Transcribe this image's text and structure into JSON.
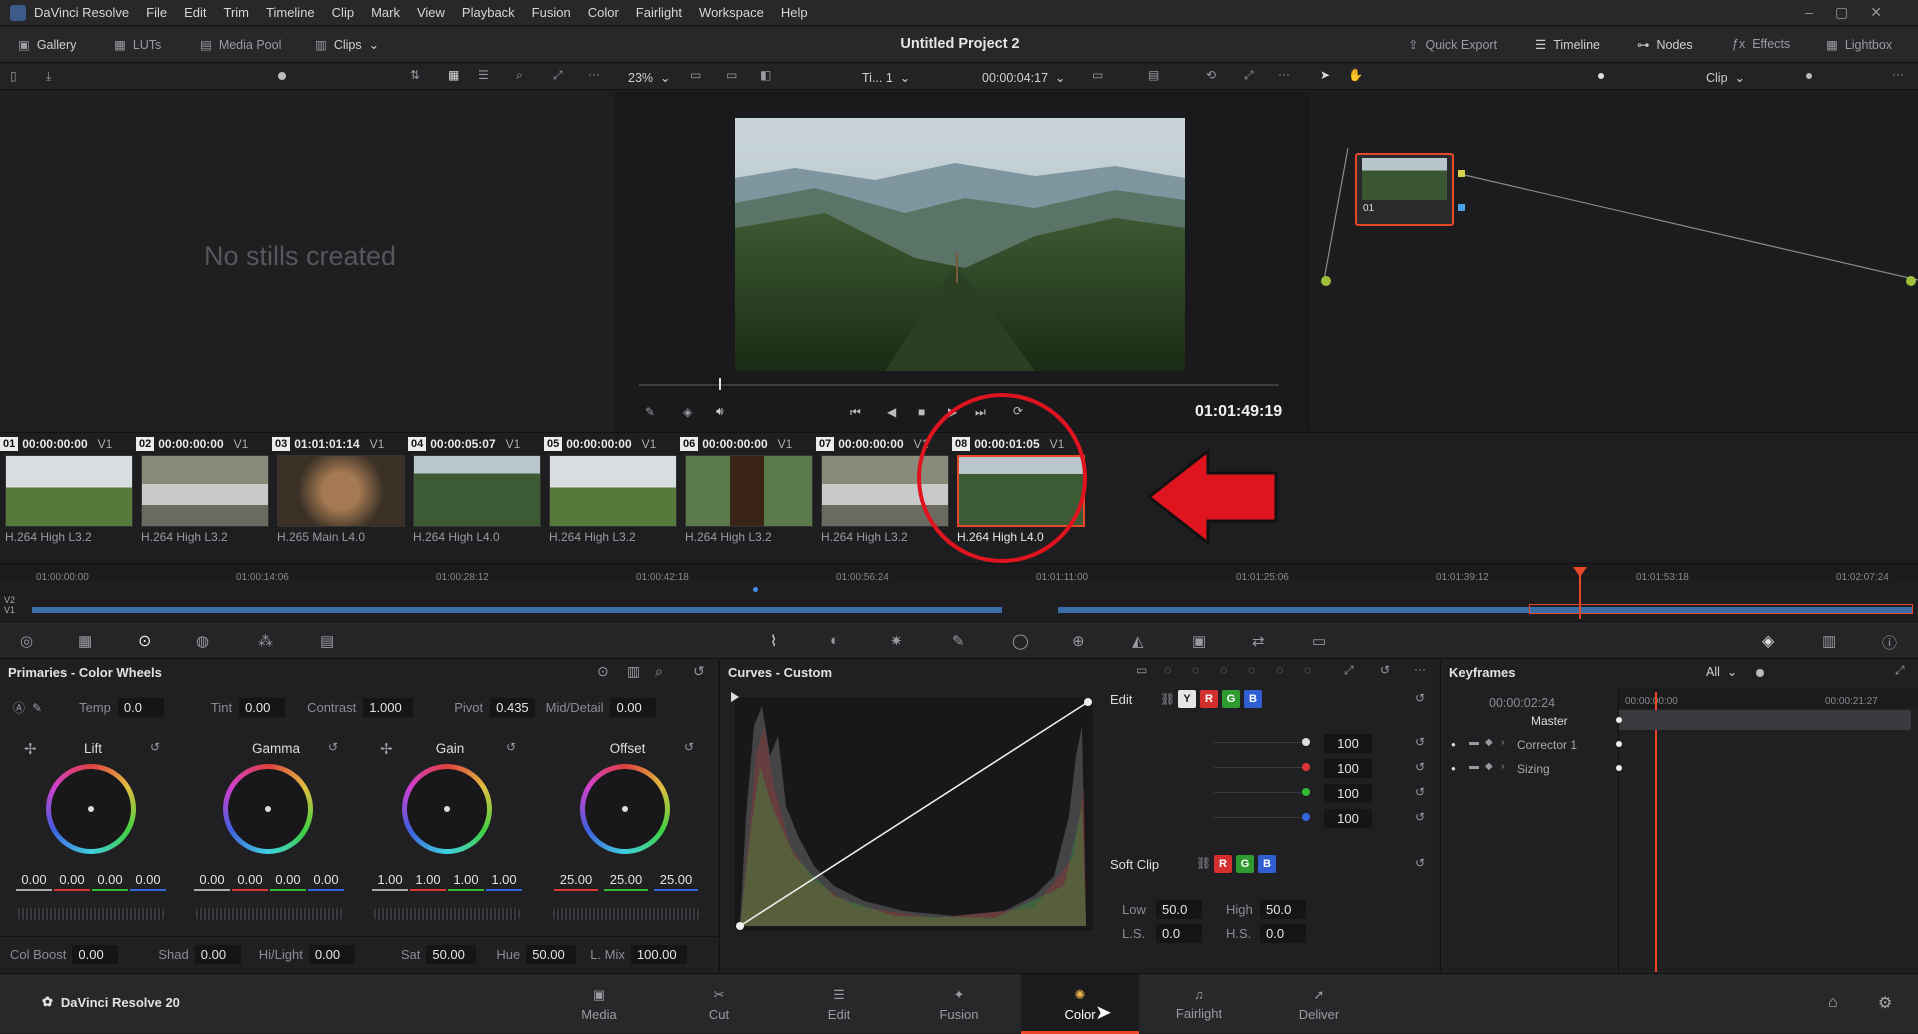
{
  "app": {
    "name": "DaVinci Resolve",
    "project_title": "Untitled Project 2",
    "brand": "DaVinci Resolve 20"
  },
  "menu": [
    "DaVinci Resolve",
    "File",
    "Edit",
    "Trim",
    "Timeline",
    "Clip",
    "Mark",
    "View",
    "Playback",
    "Fusion",
    "Color",
    "Fairlight",
    "Workspace",
    "Help"
  ],
  "toolbar": {
    "gallery": "Gallery",
    "luts": "LUTs",
    "media_pool": "Media Pool",
    "clips": "Clips",
    "quick_export": "Quick Export",
    "timeline": "Timeline",
    "nodes": "Nodes",
    "effects": "Effects",
    "lightbox": "Lightbox"
  },
  "viewer": {
    "zoom": "23%",
    "timeline_name": "Ti... 1",
    "timecode_top": "00:00:04:17",
    "timecode": "01:01:49:19",
    "mode": "Clip"
  },
  "gallery": {
    "empty_text": "No stills created"
  },
  "nodes": {
    "node_label": "01"
  },
  "clips": [
    {
      "num": "01",
      "tc": "00:00:00:00",
      "track": "V1",
      "codec": "H.264 High L3.2"
    },
    {
      "num": "02",
      "tc": "00:00:00:00",
      "track": "V1",
      "codec": "H.264 High L3.2"
    },
    {
      "num": "03",
      "tc": "01:01:01:14",
      "track": "V1",
      "codec": "H.265 Main L4.0"
    },
    {
      "num": "04",
      "tc": "00:00:05:07",
      "track": "V1",
      "codec": "H.264 High L4.0"
    },
    {
      "num": "05",
      "tc": "00:00:00:00",
      "track": "V1",
      "codec": "H.264 High L3.2"
    },
    {
      "num": "06",
      "tc": "00:00:00:00",
      "track": "V1",
      "codec": "H.264 High L3.2"
    },
    {
      "num": "07",
      "tc": "00:00:00:00",
      "track": "V1",
      "codec": "H.264 High L3.2"
    },
    {
      "num": "08",
      "tc": "00:00:01:05",
      "track": "V1",
      "codec": "H.264 High L4.0"
    }
  ],
  "mini_timeline": {
    "tracks": [
      "V2",
      "V1"
    ],
    "ruler": [
      "01:00:00:00",
      "01:00:14:06",
      "01:00:28:12",
      "01:00:42:18",
      "01:00:56:24",
      "01:01:11:00",
      "01:01:25:06",
      "01:01:39:12",
      "01:01:53:18",
      "01:02:07:24"
    ]
  },
  "primaries": {
    "title": "Primaries - Color Wheels",
    "temp_label": "Temp",
    "temp": "0.0",
    "tint_label": "Tint",
    "tint": "0.00",
    "contrast_label": "Contrast",
    "contrast": "1.000",
    "pivot_label": "Pivot",
    "pivot": "0.435",
    "middetail_label": "Mid/Detail",
    "middetail": "0.00",
    "wheels": [
      {
        "name": "Lift",
        "values": [
          "0.00",
          "0.00",
          "0.00",
          "0.00"
        ]
      },
      {
        "name": "Gamma",
        "values": [
          "0.00",
          "0.00",
          "0.00",
          "0.00"
        ]
      },
      {
        "name": "Gain",
        "values": [
          "1.00",
          "1.00",
          "1.00",
          "1.00"
        ]
      },
      {
        "name": "Offset",
        "values": [
          "25.00",
          "25.00",
          "25.00"
        ]
      }
    ],
    "colboost_label": "Col Boost",
    "colboost": "0.00",
    "shad_label": "Shad",
    "shad": "0.00",
    "hilight_label": "Hi/Light",
    "hilight": "0.00",
    "sat_label": "Sat",
    "sat": "50.00",
    "hue_label": "Hue",
    "hue": "50.00",
    "lmix_label": "L. Mix",
    "lmix": "100.00"
  },
  "curves": {
    "title": "Curves - Custom",
    "edit_label": "Edit",
    "channels": [
      "Y",
      "R",
      "G",
      "B"
    ],
    "intensity": [
      "100",
      "100",
      "100",
      "100"
    ],
    "softclip_label": "Soft Clip",
    "low_label": "Low",
    "low": "50.0",
    "high_label": "High",
    "high": "50.0",
    "ls_label": "L.S.",
    "ls": "0.0",
    "hs_label": "H.S.",
    "hs": "0.0"
  },
  "keyframes": {
    "title": "Keyframes",
    "filter": "All",
    "timecode": "00:00:02:24",
    "ruler_start": "00:00:00:00",
    "ruler_end": "00:00:21:27",
    "rows": [
      "Master",
      "Corrector 1",
      "Sizing"
    ]
  },
  "pages": [
    "Media",
    "Cut",
    "Edit",
    "Fusion",
    "Color",
    "Fairlight",
    "Deliver"
  ],
  "active_page": "Color",
  "colors": {
    "accent": "#e8472a",
    "annotation": "#e0141e",
    "panel": "#202023"
  }
}
